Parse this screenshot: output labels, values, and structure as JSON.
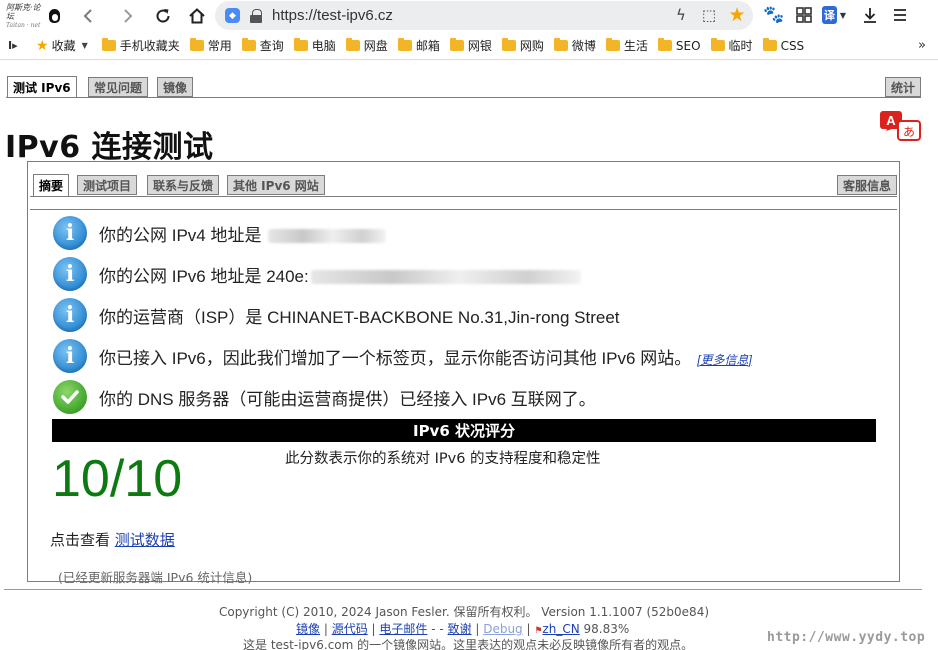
{
  "browser": {
    "logo_text_line1": "阿斯克·论坛",
    "logo_text_line2": "Taitan · net",
    "url": "https://test-ipv6.cz",
    "translate_label": "译"
  },
  "bookmarks": {
    "items": [
      "收藏",
      "手机收藏夹",
      "常用",
      "查询",
      "电脑",
      "网盘",
      "邮箱",
      "网银",
      "网购",
      "微博",
      "生活",
      "SEO",
      "临时",
      "CSS"
    ],
    "more": "»"
  },
  "page": {
    "tabs": [
      "测试 IPv6",
      "常见问题",
      "镜像"
    ],
    "stats_tab": "统计",
    "title": "IPv6 连接测试",
    "subtabs": [
      "摘要",
      "测试项目",
      "联系与反馈",
      "其他 IPv6 网站"
    ],
    "support_tab": "客服信息",
    "results": [
      {
        "icon": "info",
        "prefix": "你的公网 IPv4 地址是 ",
        "value_visible": ""
      },
      {
        "icon": "info",
        "prefix": "你的公网 IPv6 地址是 ",
        "value_visible": "240e:"
      },
      {
        "icon": "info",
        "prefix": "你的运营商（ISP）是 CHINANET-BACKBONE No.31,Jin-rong Street",
        "value_visible": ""
      },
      {
        "icon": "info",
        "prefix": "你已接入 IPv6，因此我们增加了一个标签页，显示你能否访问其他 IPv6 网站。",
        "value_visible": ""
      },
      {
        "icon": "ok",
        "prefix": "你的 DNS 服务器（可能由运营商提供）已经接入 IPv6 互联网了。",
        "value_visible": ""
      }
    ],
    "more_info": "[更多信息]",
    "score_header": "IPv6 状况评分",
    "score": "10/10",
    "score_desc": "此分数表示你的系统对 IPv6 的支持程度和稳定性",
    "test_data_prefix": "点击查看 ",
    "test_data_link": "测试数据",
    "updated_note": "(已经更新服务器端 IPv6 统计信息)"
  },
  "footer": {
    "copyright": "Copyright (C) 2010, 2024 Jason Fesler. 保留所有权利。 Version 1.1.1007 (52b0e84)",
    "links": [
      "镜像",
      "源代码",
      "电子邮件",
      "致谢",
      "Debug",
      "zh_CN"
    ],
    "locale_pct": "98.83%",
    "mirror_note": "这是 test-ipv6.com 的一个镜像网站。这里表达的观点未必反映镜像所有者的观点。",
    "watermark": "http://www.yydy.top"
  },
  "colors": {
    "score_green": "#0d7a11",
    "link_blue": "#1a3fb3",
    "star_orange": "#f7a600",
    "folder_yellow": "#f2b527"
  }
}
